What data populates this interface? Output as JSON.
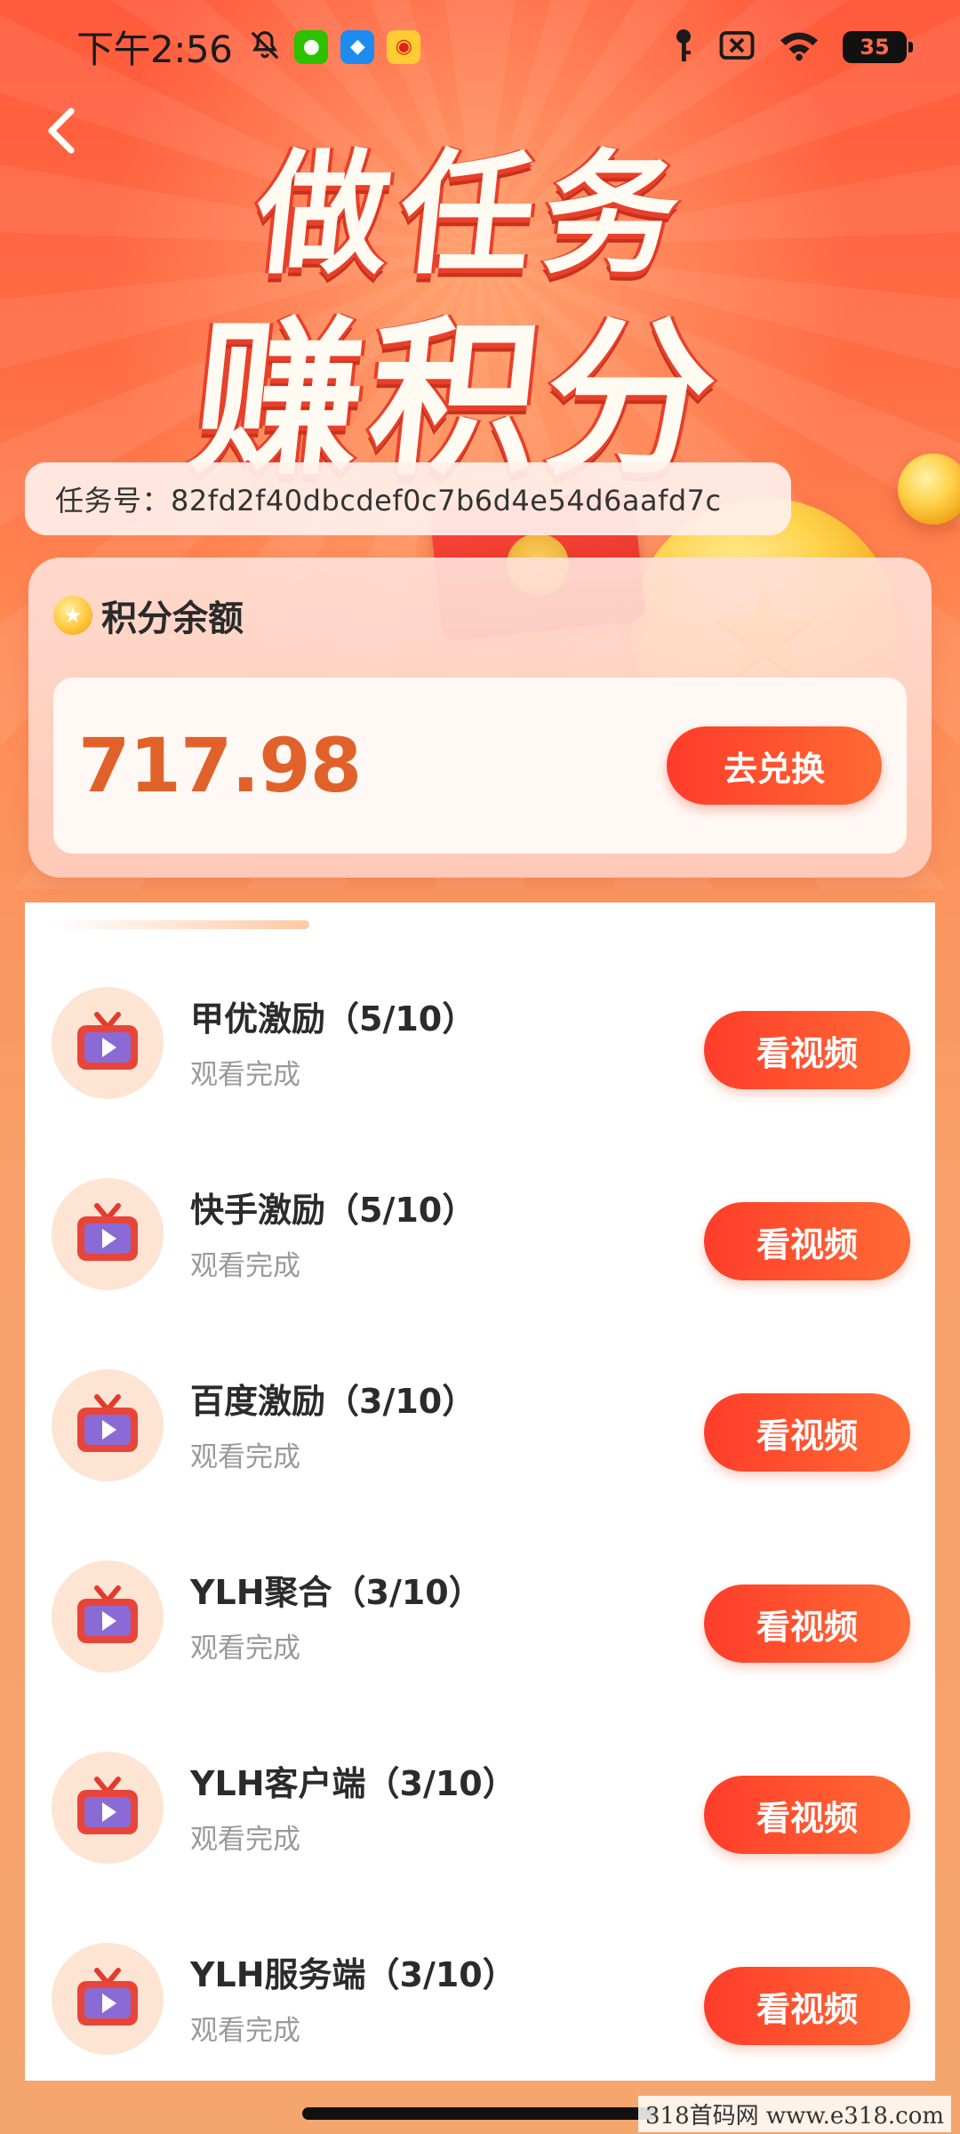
{
  "status_bar": {
    "time": "下午2:56",
    "battery": "35"
  },
  "hero": {
    "line1": "做任务",
    "line2": "赚积分"
  },
  "task_id": {
    "label": "任务号：82fd2f40dbcdef0c7b6d4e54d6aafd7c"
  },
  "points": {
    "title": "积分余额",
    "value": "717.98",
    "exchange_label": "去兑换"
  },
  "tasks": [
    {
      "name": "甲优激励（5/10）",
      "status": "观看完成",
      "button": "看视频"
    },
    {
      "name": "快手激励（5/10）",
      "status": "观看完成",
      "button": "看视频"
    },
    {
      "name": "百度激励（3/10）",
      "status": "观看完成",
      "button": "看视频"
    },
    {
      "name": "YLH聚合（3/10）",
      "status": "观看完成",
      "button": "看视频"
    },
    {
      "name": "YLH客户端（3/10）",
      "status": "观看完成",
      "button": "看视频"
    },
    {
      "name": "YLH服务端（3/10）",
      "status": "观看完成",
      "button": "看视频"
    }
  ],
  "watermark": "318首码网  www.e318.com",
  "colors": {
    "accent": "#ff4a2e",
    "points_value": "#e0622a",
    "background_top": "#ff5a3b",
    "background_bottom": "#f5a56e"
  },
  "icons": [
    "back-arrow-icon",
    "mute-icon",
    "wechat-icon",
    "safari-icon",
    "weibo-icon",
    "key-icon",
    "sim-off-icon",
    "wifi-icon",
    "battery-icon",
    "coin-icon",
    "tv-play-icon"
  ]
}
